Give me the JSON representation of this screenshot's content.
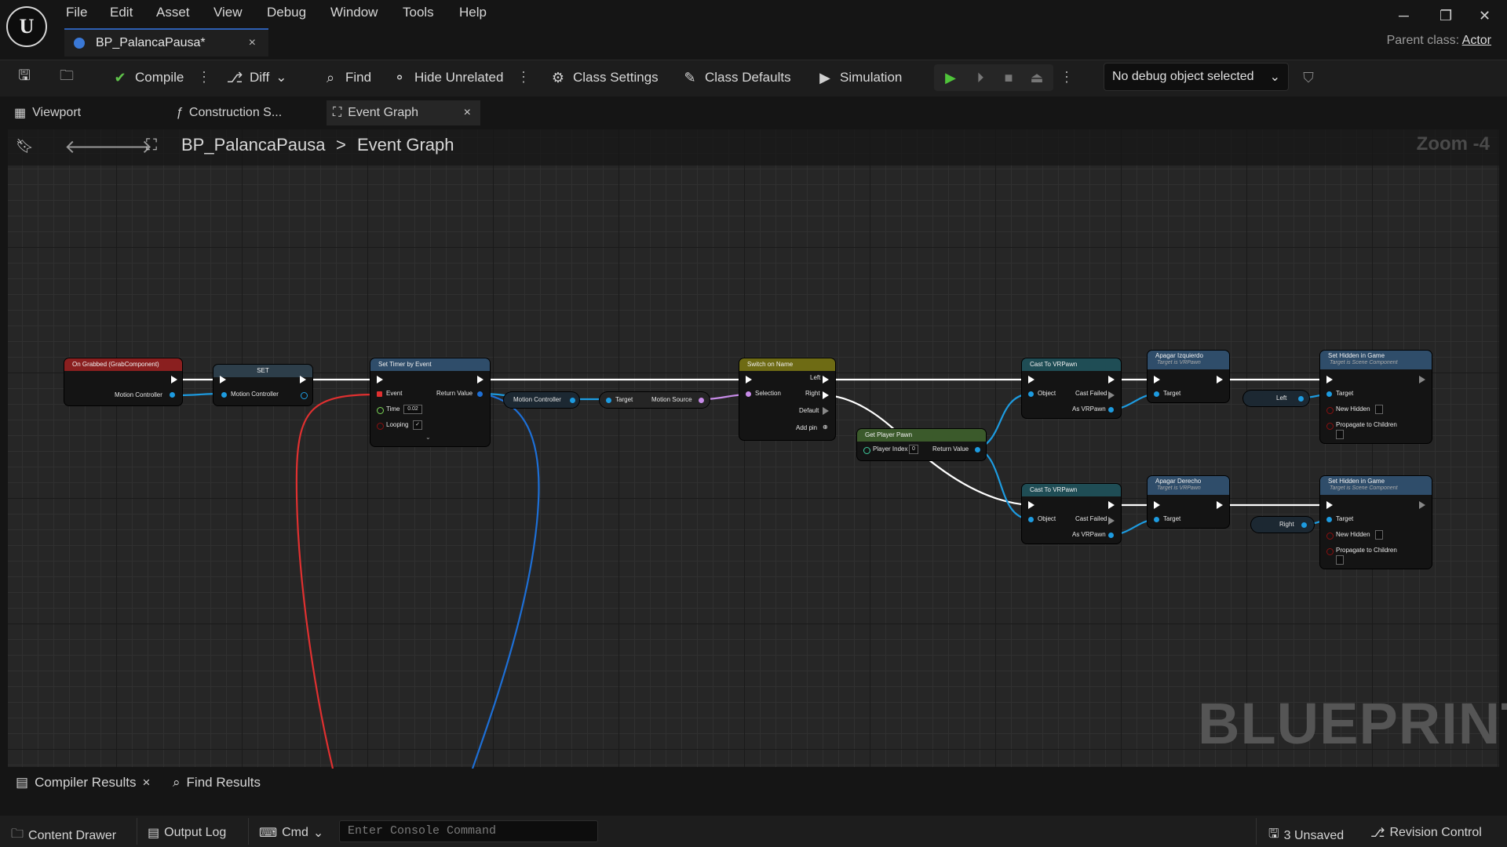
{
  "menu": {
    "file": "File",
    "edit": "Edit",
    "asset": "Asset",
    "view": "View",
    "debug": "Debug",
    "window": "Window",
    "tools": "Tools",
    "help": "Help"
  },
  "document_tab": {
    "label": "BP_PalancaPausa*",
    "close": "×"
  },
  "parent_class": {
    "label": "Parent class:",
    "value": "Actor"
  },
  "toolbar": {
    "compile": "Compile",
    "diff": "Diff",
    "find": "Find",
    "hide_unrelated": "Hide Unrelated",
    "class_settings": "Class Settings",
    "class_defaults": "Class Defaults",
    "simulation": "Simulation",
    "debug_object": "No debug object selected"
  },
  "editor_tabs": {
    "viewport": "Viewport",
    "construction": "Construction S...",
    "event_graph": "Event Graph",
    "close": "×"
  },
  "breadcrumb": {
    "blueprint": "BP_PalancaPausa",
    "separator": ">",
    "graph": "Event Graph"
  },
  "zoom": "Zoom -4",
  "watermark": "BLUEPRINT",
  "nodes": {
    "on_grabbed": {
      "title": "On Grabbed (GrabComponent)",
      "pin": "Motion Controller"
    },
    "set": {
      "title": "SET",
      "pin": "Motion Controller"
    },
    "set_timer": {
      "title": "Set Timer by Event",
      "event": "Event",
      "return": "Return Value",
      "time": "Time",
      "time_value": "0.02",
      "looping": "Looping"
    },
    "motion_controller_var": {
      "label": "Motion Controller"
    },
    "motion_source": {
      "target": "Target",
      "source": "Motion Source"
    },
    "switch": {
      "title": "Switch on Name",
      "left": "Left",
      "selection": "Selection",
      "right": "Right",
      "default": "Default",
      "add_pin": "Add pin"
    },
    "get_player_pawn": {
      "title": "Get Player Pawn",
      "player_index": "Player Index",
      "index_value": "0",
      "return": "Return Value"
    },
    "cast1": {
      "title": "Cast To VRPawn",
      "object": "Object",
      "failed": "Cast Failed",
      "as": "As VRPawn"
    },
    "cast2": {
      "title": "Cast To VRPawn",
      "object": "Object",
      "failed": "Cast Failed",
      "as": "As VRPawn"
    },
    "apagar_izq": {
      "title": "Apagar Izquierdo",
      "sub": "Target is VRPawn",
      "target": "Target"
    },
    "apagar_der": {
      "title": "Apagar Derecho",
      "sub": "Target is VRPawn",
      "target": "Target"
    },
    "left_var": {
      "label": "Left"
    },
    "right_var": {
      "label": "Right"
    },
    "hidden1": {
      "title": "Set Hidden in Game",
      "sub": "Target is Scene Component",
      "target": "Target",
      "new_hidden": "New Hidden",
      "propagate": "Propagate to Children"
    },
    "hidden2": {
      "title": "Set Hidden in Game",
      "sub": "Target is Scene Component",
      "target": "Target",
      "new_hidden": "New Hidden",
      "propagate": "Propagate to Children"
    }
  },
  "bottom_tabs": {
    "compiler_results": "Compiler Results",
    "close": "×",
    "find_results": "Find Results"
  },
  "statusbar": {
    "content_drawer": "Content Drawer",
    "output_log": "Output Log",
    "cmd": "Cmd",
    "console_placeholder": "Enter Console Command",
    "unsaved": "3 Unsaved",
    "revision_control": "Revision Control"
  },
  "colors": {
    "event_header": "#8a1f1f",
    "function_header": "#2f4d6a",
    "switch_header": "#6e6b14",
    "pure_header": "#3b5a2b",
    "cast_header": "#1f4d55",
    "exec": "#ffffff",
    "object_pin": "#1d9be0",
    "bool_pin": "#8a1010",
    "name_pin": "#c78be8",
    "delegate_pin": "#e03030"
  }
}
